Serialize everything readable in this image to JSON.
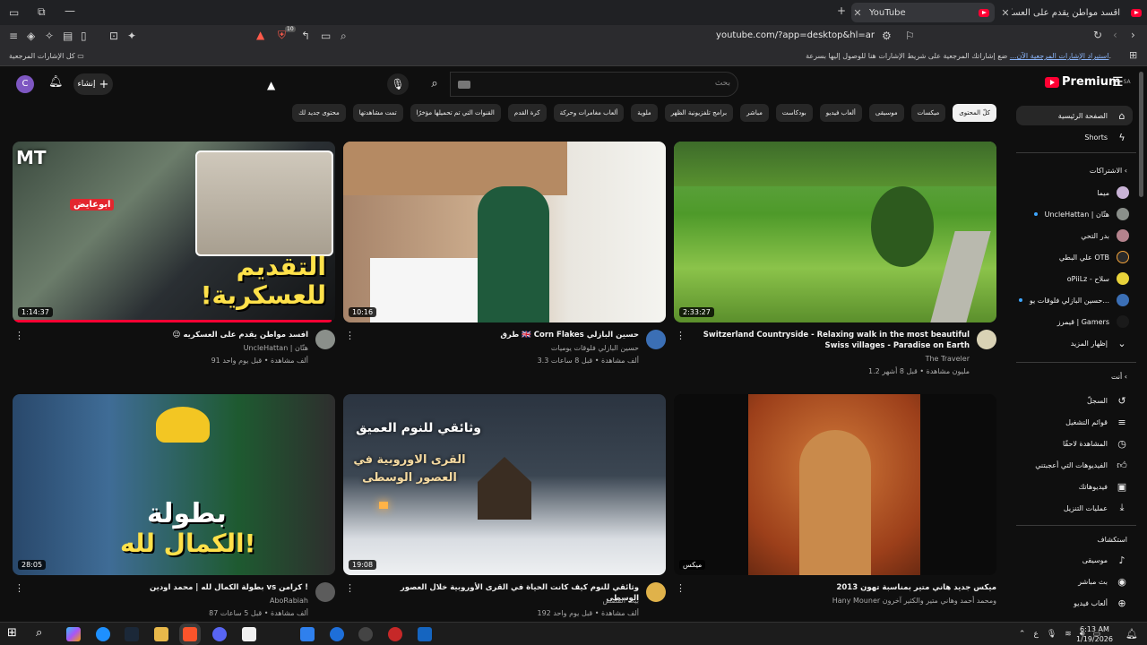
{
  "browser": {
    "tabs": [
      {
        "title": "YouTube",
        "active": true
      },
      {
        "title": "اقسد مواطن يقدم على العسكريه",
        "active": false
      }
    ],
    "url": "youtube.com/?app=desktop&hl=ar",
    "bookmarks_bar": {
      "all_bookmarks": "كل الإشارات المرجعية",
      "hint": "ضع إشاراتك المرجعية على شريط الإشارات هنا للوصول إليها بسرعة.",
      "import_link": "استيراد الإشارات المرجعية الآن..."
    },
    "extension_badge": "10"
  },
  "header": {
    "avatar_letter": "C",
    "create_label": "إنشاء",
    "search_placeholder": "بحث",
    "logo_text": "Premium",
    "region": "SA"
  },
  "chips": [
    "الكل",
    "ميكسات",
    "موسيقى",
    "ألعاب فيديو",
    "بودكاست",
    "مباشر",
    "برامج تلفزيونية الظهر",
    "ملوية",
    "ألعاب مغامرات وحركة",
    "كرة القدم",
    "القنوات التي تم تحميلها مؤخرًا",
    "تمت مشاهدتها",
    "محتوى جديد لك"
  ],
  "chip_selected_label": "كلّ المحتوى",
  "videos": [
    {
      "title": "😉 افسد مواطن يقدم على العسكريه",
      "channel": "UncleHattan | هتّان",
      "stats": "91 ألف مشاهدة • قبل يوم واحد",
      "duration": "1:14:37",
      "thumb_text": "التقديم للعسكرية!",
      "thumb_badge": "ابوعايض",
      "logo": "MT",
      "watched_fraction": 0.99
    },
    {
      "title": "طرق 🇬🇧 Corn Flakes حسين البازلي",
      "channel": "حسين البازلي فلوقات يوميات",
      "stats": "3.3 ألف مشاهدة • قبل 8 ساعات",
      "duration": "10:16"
    },
    {
      "title": "Switzerland Countryside - Relaxing walk in the most beautiful Swiss villages - Paradise on Earth",
      "channel": "The Traveler",
      "stats": "1.2 مليون مشاهدة • قبل 8 أشهر",
      "duration": "2:33:27"
    },
    {
      "title": "بطولة الكمال لله | محمد اودين vs كرامن !",
      "channel": "AboRabiah",
      "stats": "87 ألف مشاهدة • قبل 5 ساعات",
      "duration": "28:05",
      "thumb_text_1": "بطولة",
      "thumb_text_2": "الكمال لله!"
    },
    {
      "title": "وثائقي للنوم كيف كانت الحياة في القرى الأوروبية خلال العصور الوسطى",
      "channel": "بيت القصص",
      "stats": "192 ألف مشاهدة • قبل يوم واحد",
      "duration": "19:08",
      "thumb_text_1": "وثائقي للنوم العميق",
      "thumb_text_2": "القرى الاوروبية في العصور الوسطى"
    },
    {
      "title": "ميكس جديد هاني متير بمناسبة تهون 2013",
      "channel": "Hany Mouner ومحمد أحمد وهاني متير والكثير آخرون",
      "stats": "",
      "duration": "ميكس"
    }
  ],
  "sidebar": {
    "home": "الصفحة الرئيسية",
    "shorts": "Shorts",
    "subscriptions_head": "الاشتراكات",
    "subscriptions": [
      {
        "name": "ميما",
        "dot": false
      },
      {
        "name": "UncleHattan | هتّان",
        "dot": true
      },
      {
        "name": "بدر التحي",
        "dot": false
      },
      {
        "name": "علي البطي OTB",
        "dot": false
      },
      {
        "name": "oPiiLz - سلاح",
        "dot": false
      },
      {
        "name": "حسين البازلي فلوقات يو...",
        "dot": true
      },
      {
        "name": "قيمرز | Gamers",
        "dot": false
      }
    ],
    "show_more": "إظهار المزيد",
    "you_head": "أنت",
    "you_items": [
      "السجلّ",
      "قوائم التشغيل",
      "المشاهدة لاحقًا",
      "الفيديوهات التي أعجبتني",
      "فيديوهاتك",
      "عمليات التنزيل"
    ],
    "explore_head": "استكشاف",
    "explore_items": [
      "موسيقى",
      "بث مباشر",
      "ألعاب فيديو"
    ]
  },
  "taskbar": {
    "time": "6:13 AM",
    "date": "1/19/2026",
    "lang": "ع"
  },
  "colors": {
    "yt_red": "#ff0033",
    "bg": "#0f0f0f",
    "chip_bg": "#272727"
  }
}
